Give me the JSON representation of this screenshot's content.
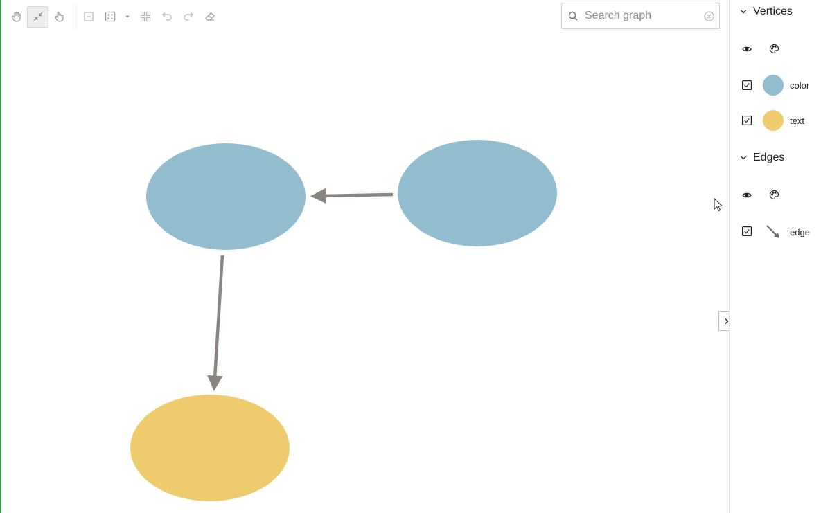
{
  "search": {
    "placeholder": "Search graph",
    "value": ""
  },
  "toolbar": {
    "icons": [
      "pan-hand-icon",
      "fit-to-screen-icon",
      "select-hand-icon",
      "collapse-icon",
      "layout-grid-icon",
      "layout-dropdown-icon",
      "group-icon",
      "undo-icon",
      "redo-icon",
      "eraser-icon"
    ]
  },
  "sidebar": {
    "vertices": {
      "title": "Vertices",
      "items": [
        {
          "label": "color",
          "checked": true,
          "swatch": "#92bdcf"
        },
        {
          "label": "text",
          "checked": true,
          "swatch": "#eecc6e"
        }
      ]
    },
    "edges": {
      "title": "Edges",
      "items": [
        {
          "label": "edge",
          "checked": true,
          "color": "#8a8580"
        }
      ]
    }
  },
  "graph": {
    "vertex_colors": {
      "color": "#92bdcf",
      "text": "#eecc6e"
    },
    "edge_color": "#8a8580",
    "vertices": [
      {
        "id": "v1",
        "category": "color"
      },
      {
        "id": "v2",
        "category": "color"
      },
      {
        "id": "v3",
        "category": "text"
      }
    ],
    "edges": [
      {
        "from": "v2",
        "to": "v1"
      },
      {
        "from": "v1",
        "to": "v3"
      }
    ]
  }
}
